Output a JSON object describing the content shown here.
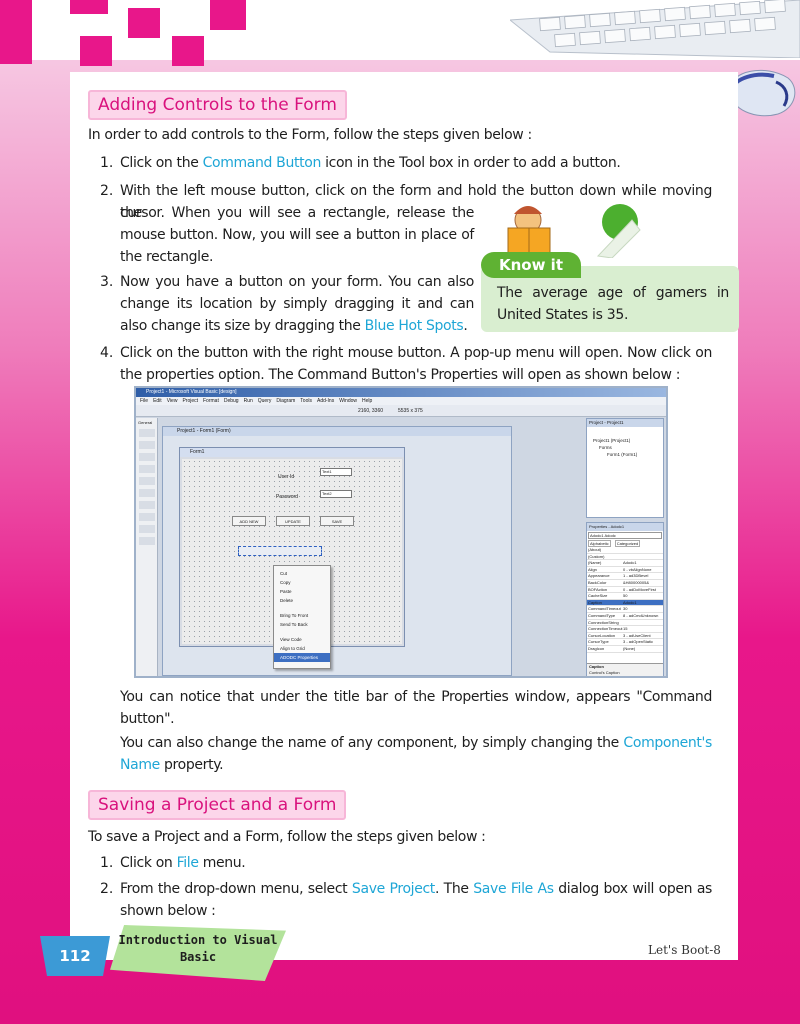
{
  "section1": {
    "heading": "Adding Controls to the Form",
    "intro": "In order to add controls to the Form, follow the steps given below :",
    "step1": {
      "num": "1.",
      "before": "Click on the ",
      "highlight": "Command Button",
      "after": " icon in the Tool box in order to add a button."
    },
    "step2": {
      "num": "2.",
      "line1": "With the left mouse button, click on the form and hold the button down while moving the",
      "rest": "cursor. When you will see a rectangle, release the mouse button. Now, you will see a button in place of the rectangle."
    },
    "step3": {
      "num": "3.",
      "before": "Now you have a button on your form. You can also change its location by simply dragging it and can also change its size by dragging the ",
      "highlight": "Blue Hot Spots",
      "after": "."
    },
    "step4": {
      "num": "4.",
      "text": "Click on the button with the right mouse button. A pop-up menu will open. Now click on the properties option. The Command Button's Properties will open as shown below :"
    }
  },
  "know_it": {
    "label": "Know it",
    "text": "The average age of gamers in United States is 35."
  },
  "screenshot": {
    "title": "Project1 - Microsoft Visual Basic [design]",
    "menus": [
      "File",
      "Edit",
      "View",
      "Project",
      "Format",
      "Debug",
      "Run",
      "Query",
      "Diagram",
      "Tools",
      "Add-Ins",
      "Window",
      "Help"
    ],
    "toolbar_pos": "2160, 3360",
    "toolbar_size": "5535 x 375",
    "general_label": "General",
    "mdi_title": "Project1 - Form1 (Form)",
    "form_title": "Form1",
    "labels": {
      "user": "User Id",
      "password": "Password",
      "text1": "Text1",
      "text2": "Text2"
    },
    "buttons": {
      "add": "ADD NEW",
      "update": "UPDATE",
      "save": "SAVE"
    },
    "context_menu": [
      "Cut",
      "Copy",
      "Paste",
      "Delete",
      "Bring To Front",
      "Send To Back",
      "View Code",
      "Align to Grid",
      "ADODC Properties"
    ],
    "project_panel": {
      "title": "Project - Project1",
      "root": "Project1 (Project1)",
      "forms": "Forms",
      "form1": "Form1 (Form1)"
    },
    "properties_panel": {
      "title": "Properties - Adodc1",
      "object": "Adodc1 Adodc",
      "tabs": [
        "Alphabetic",
        "Categorized"
      ],
      "rows": [
        [
          "(About)",
          ""
        ],
        [
          "(Custom)",
          ""
        ],
        [
          "(Name)",
          "Adodc1"
        ],
        [
          "Align",
          "0 - vbAlignNone"
        ],
        [
          "Appearance",
          "1 - ad3DBevel"
        ],
        [
          "BackColor",
          "&H80000005&"
        ],
        [
          "BOFAction",
          "0 - adDoMoveFirst"
        ],
        [
          "CacheSize",
          "50"
        ],
        [
          "Caption",
          "Adodc1"
        ],
        [
          "CommandTimeout",
          "30"
        ],
        [
          "CommandType",
          "8 - adCmdUnknown"
        ],
        [
          "ConnectionString",
          ""
        ],
        [
          "ConnectionTimeout",
          "15"
        ],
        [
          "CursorLocation",
          "3 - adUseClient"
        ],
        [
          "CursorType",
          "3 - adOpenStatic"
        ],
        [
          "DragIcon",
          "(None)"
        ]
      ],
      "desc_title": "Caption",
      "desc_text": "Control's Caption"
    }
  },
  "after_shot": {
    "p1": "You can notice that under the title bar of the Properties window, appears \"Command button\".",
    "p2_before": "You can also change the name of any component, by simply changing the ",
    "p2_highlight": "Component's Name",
    "p2_after": " property."
  },
  "section2": {
    "heading": "Saving a Project and a Form",
    "intro": "To save a Project and a Form, follow the steps given below :",
    "step1": {
      "num": "1.",
      "before": "Click on ",
      "highlight": "File",
      "after": " menu."
    },
    "step2": {
      "num": "2.",
      "before": "From the drop-down menu, select ",
      "hl1": "Save Project",
      "mid": ". The ",
      "hl2": "Save File As",
      "after": " dialog box will open as shown below :"
    }
  },
  "footer": {
    "page_number": "112",
    "chapter": "Introduction to Visual Basic",
    "book": "Let's Boot-8"
  }
}
